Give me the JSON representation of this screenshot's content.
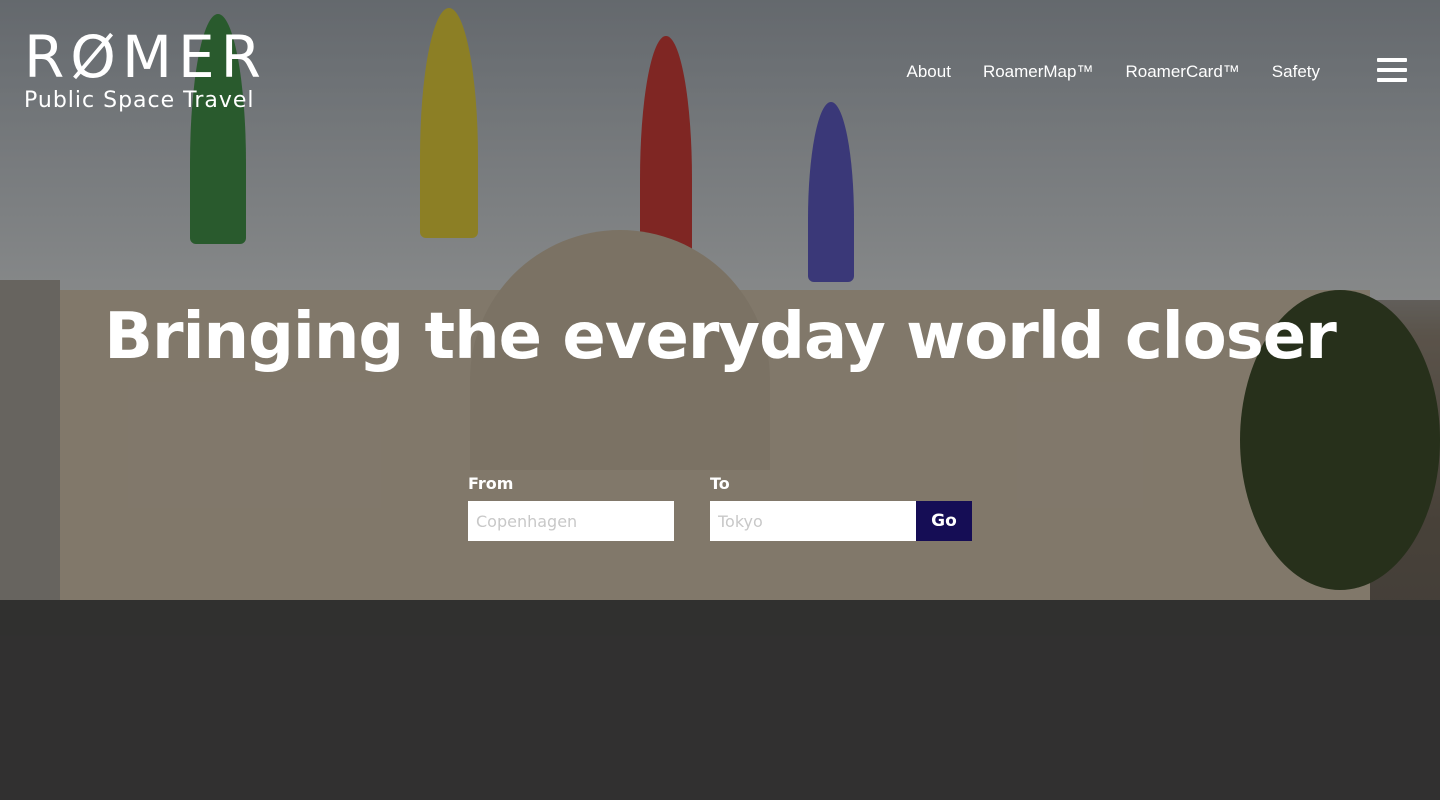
{
  "brand": {
    "name": "RØMER",
    "tagline": "Public Space Travel"
  },
  "nav": {
    "items": [
      "About",
      "RoamerMap™",
      "RoamerCard™",
      "Safety"
    ],
    "menu_icon": "hamburger-menu-icon"
  },
  "hero": {
    "headline": "Bringing the everyday world closer",
    "from_label": "From",
    "to_label": "To",
    "from_placeholder": "Copenhagen",
    "to_placeholder": "Tokyo",
    "go_label": "Go"
  },
  "colors": {
    "go_button": "#150d55",
    "text": "#ffffff"
  }
}
